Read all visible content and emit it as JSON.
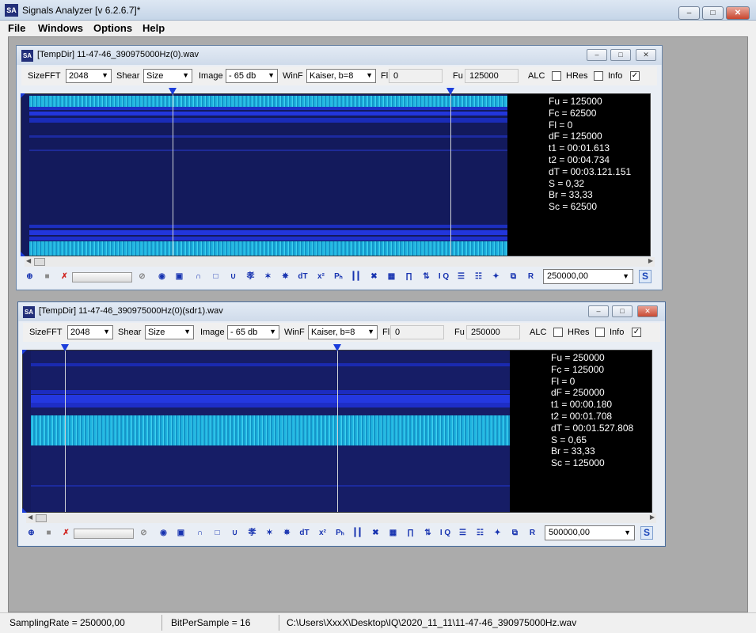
{
  "app": {
    "title": "Signals Analyzer [v 6.2.6.7]*",
    "icon": "SA",
    "controls": {
      "minimize": "–",
      "maximize": "□",
      "close": "✕"
    }
  },
  "menu": [
    "File",
    "Windows",
    "Options",
    "Help"
  ],
  "windows": [
    {
      "title": "[TempDir] 11-47-46_390975000Hz(0).wav",
      "size_fft_label": "SizeFFT",
      "size_fft": "2048",
      "shear_label": "Shear",
      "shear": "Size",
      "image_label": "Image",
      "image": "- 65 db",
      "winf_label": "WinF",
      "winf": "Kaiser, b=8",
      "fl_label": "Fl",
      "fl": "0",
      "fu_label": "Fu",
      "fu": "125000",
      "alc_label": "ALC",
      "alc_checked": false,
      "hres_label": "HRes",
      "hres_checked": false,
      "info_label": "Info",
      "info_checked": true,
      "info": [
        "Fu = 125000",
        "Fc = 62500",
        "Fl = 0",
        "dF = 125000",
        "t1 = 00:01.613",
        "t2 = 00:04.734",
        "dT = 00:03.121.151",
        "S = 0,32",
        "Br = 33,33",
        "Sc = 62500"
      ],
      "freq_value": "250000,00",
      "s_button": "S"
    },
    {
      "title": "[TempDir] 11-47-46_390975000Hz(0)(sdr1).wav",
      "size_fft_label": "SizeFFT",
      "size_fft": "2048",
      "shear_label": "Shear",
      "shear": "Size",
      "image_label": "Image",
      "image": "- 65 db",
      "winf_label": "WinF",
      "winf": "Kaiser, b=8",
      "fl_label": "Fl",
      "fl": "0",
      "fu_label": "Fu",
      "fu": "250000",
      "alc_label": "ALC",
      "alc_checked": false,
      "hres_label": "HRes",
      "hres_checked": false,
      "info_label": "Info",
      "info_checked": true,
      "info": [
        "Fu = 250000",
        "Fc = 125000",
        "Fl = 0",
        "dF = 250000",
        "t1 = 00:00.180",
        "t2 = 00:01.708",
        "dT = 00:01.527.808",
        "S = 0,65",
        "Br = 33,33",
        "Sc = 125000"
      ],
      "freq_value": "500000,00",
      "s_button": "S"
    }
  ],
  "iconbar_glyphs": [
    "⊕",
    "■",
    "✗",
    "",
    "⊘",
    "◉",
    "▣",
    "∩",
    "□",
    "∪",
    "孝",
    "✶",
    "✵",
    "dT",
    "x²",
    "Pₕ",
    "┃┃",
    "✖",
    "▦",
    "∏",
    "⇅",
    "I Q",
    "☰",
    "☷",
    "✦",
    "⧉",
    "R"
  ],
  "status": {
    "sampling_rate": "SamplingRate = 250000,00",
    "bit_per_sample": "BitPerSample = 16",
    "file_path": "C:\\Users\\XxxX\\Desktop\\IQ\\2020_11_11\\11-47-46_390975000Hz.wav"
  },
  "colors": {
    "spectrogram_bg": "#141a5e",
    "signal_cyan": "#22b7e4",
    "band_blue": "#2434d8",
    "marker": "#1b3ddb"
  }
}
